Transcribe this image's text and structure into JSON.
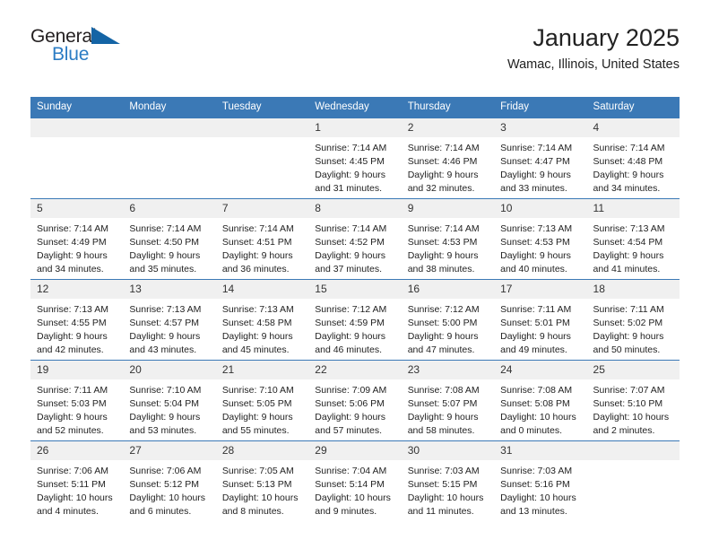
{
  "brand": {
    "word_one": "General",
    "word_two": "Blue",
    "triangle_icon": "triangle-logo-icon",
    "colors": {
      "dark": "#231f20",
      "blue": "#2b7cc4",
      "triangle": "#1464a5"
    }
  },
  "header": {
    "title": "January 2025",
    "subtitle": "Wamac, Illinois, United States"
  },
  "theme": {
    "header_blue": "#3b79b6",
    "daynum_band": "#f0f0f0",
    "text": "#222222"
  },
  "weekdays": [
    "Sunday",
    "Monday",
    "Tuesday",
    "Wednesday",
    "Thursday",
    "Friday",
    "Saturday"
  ],
  "weeks": [
    [
      {
        "day": "",
        "empty": true,
        "lines": []
      },
      {
        "day": "",
        "empty": true,
        "lines": []
      },
      {
        "day": "",
        "empty": true,
        "lines": []
      },
      {
        "day": "1",
        "empty": false,
        "lines": [
          "Sunrise: 7:14 AM",
          "Sunset: 4:45 PM",
          "Daylight: 9 hours",
          "and 31 minutes."
        ]
      },
      {
        "day": "2",
        "empty": false,
        "lines": [
          "Sunrise: 7:14 AM",
          "Sunset: 4:46 PM",
          "Daylight: 9 hours",
          "and 32 minutes."
        ]
      },
      {
        "day": "3",
        "empty": false,
        "lines": [
          "Sunrise: 7:14 AM",
          "Sunset: 4:47 PM",
          "Daylight: 9 hours",
          "and 33 minutes."
        ]
      },
      {
        "day": "4",
        "empty": false,
        "lines": [
          "Sunrise: 7:14 AM",
          "Sunset: 4:48 PM",
          "Daylight: 9 hours",
          "and 34 minutes."
        ]
      }
    ],
    [
      {
        "day": "5",
        "empty": false,
        "lines": [
          "Sunrise: 7:14 AM",
          "Sunset: 4:49 PM",
          "Daylight: 9 hours",
          "and 34 minutes."
        ]
      },
      {
        "day": "6",
        "empty": false,
        "lines": [
          "Sunrise: 7:14 AM",
          "Sunset: 4:50 PM",
          "Daylight: 9 hours",
          "and 35 minutes."
        ]
      },
      {
        "day": "7",
        "empty": false,
        "lines": [
          "Sunrise: 7:14 AM",
          "Sunset: 4:51 PM",
          "Daylight: 9 hours",
          "and 36 minutes."
        ]
      },
      {
        "day": "8",
        "empty": false,
        "lines": [
          "Sunrise: 7:14 AM",
          "Sunset: 4:52 PM",
          "Daylight: 9 hours",
          "and 37 minutes."
        ]
      },
      {
        "day": "9",
        "empty": false,
        "lines": [
          "Sunrise: 7:14 AM",
          "Sunset: 4:53 PM",
          "Daylight: 9 hours",
          "and 38 minutes."
        ]
      },
      {
        "day": "10",
        "empty": false,
        "lines": [
          "Sunrise: 7:13 AM",
          "Sunset: 4:53 PM",
          "Daylight: 9 hours",
          "and 40 minutes."
        ]
      },
      {
        "day": "11",
        "empty": false,
        "lines": [
          "Sunrise: 7:13 AM",
          "Sunset: 4:54 PM",
          "Daylight: 9 hours",
          "and 41 minutes."
        ]
      }
    ],
    [
      {
        "day": "12",
        "empty": false,
        "lines": [
          "Sunrise: 7:13 AM",
          "Sunset: 4:55 PM",
          "Daylight: 9 hours",
          "and 42 minutes."
        ]
      },
      {
        "day": "13",
        "empty": false,
        "lines": [
          "Sunrise: 7:13 AM",
          "Sunset: 4:57 PM",
          "Daylight: 9 hours",
          "and 43 minutes."
        ]
      },
      {
        "day": "14",
        "empty": false,
        "lines": [
          "Sunrise: 7:13 AM",
          "Sunset: 4:58 PM",
          "Daylight: 9 hours",
          "and 45 minutes."
        ]
      },
      {
        "day": "15",
        "empty": false,
        "lines": [
          "Sunrise: 7:12 AM",
          "Sunset: 4:59 PM",
          "Daylight: 9 hours",
          "and 46 minutes."
        ]
      },
      {
        "day": "16",
        "empty": false,
        "lines": [
          "Sunrise: 7:12 AM",
          "Sunset: 5:00 PM",
          "Daylight: 9 hours",
          "and 47 minutes."
        ]
      },
      {
        "day": "17",
        "empty": false,
        "lines": [
          "Sunrise: 7:11 AM",
          "Sunset: 5:01 PM",
          "Daylight: 9 hours",
          "and 49 minutes."
        ]
      },
      {
        "day": "18",
        "empty": false,
        "lines": [
          "Sunrise: 7:11 AM",
          "Sunset: 5:02 PM",
          "Daylight: 9 hours",
          "and 50 minutes."
        ]
      }
    ],
    [
      {
        "day": "19",
        "empty": false,
        "lines": [
          "Sunrise: 7:11 AM",
          "Sunset: 5:03 PM",
          "Daylight: 9 hours",
          "and 52 minutes."
        ]
      },
      {
        "day": "20",
        "empty": false,
        "lines": [
          "Sunrise: 7:10 AM",
          "Sunset: 5:04 PM",
          "Daylight: 9 hours",
          "and 53 minutes."
        ]
      },
      {
        "day": "21",
        "empty": false,
        "lines": [
          "Sunrise: 7:10 AM",
          "Sunset: 5:05 PM",
          "Daylight: 9 hours",
          "and 55 minutes."
        ]
      },
      {
        "day": "22",
        "empty": false,
        "lines": [
          "Sunrise: 7:09 AM",
          "Sunset: 5:06 PM",
          "Daylight: 9 hours",
          "and 57 minutes."
        ]
      },
      {
        "day": "23",
        "empty": false,
        "lines": [
          "Sunrise: 7:08 AM",
          "Sunset: 5:07 PM",
          "Daylight: 9 hours",
          "and 58 minutes."
        ]
      },
      {
        "day": "24",
        "empty": false,
        "lines": [
          "Sunrise: 7:08 AM",
          "Sunset: 5:08 PM",
          "Daylight: 10 hours",
          "and 0 minutes."
        ]
      },
      {
        "day": "25",
        "empty": false,
        "lines": [
          "Sunrise: 7:07 AM",
          "Sunset: 5:10 PM",
          "Daylight: 10 hours",
          "and 2 minutes."
        ]
      }
    ],
    [
      {
        "day": "26",
        "empty": false,
        "lines": [
          "Sunrise: 7:06 AM",
          "Sunset: 5:11 PM",
          "Daylight: 10 hours",
          "and 4 minutes."
        ]
      },
      {
        "day": "27",
        "empty": false,
        "lines": [
          "Sunrise: 7:06 AM",
          "Sunset: 5:12 PM",
          "Daylight: 10 hours",
          "and 6 minutes."
        ]
      },
      {
        "day": "28",
        "empty": false,
        "lines": [
          "Sunrise: 7:05 AM",
          "Sunset: 5:13 PM",
          "Daylight: 10 hours",
          "and 8 minutes."
        ]
      },
      {
        "day": "29",
        "empty": false,
        "lines": [
          "Sunrise: 7:04 AM",
          "Sunset: 5:14 PM",
          "Daylight: 10 hours",
          "and 9 minutes."
        ]
      },
      {
        "day": "30",
        "empty": false,
        "lines": [
          "Sunrise: 7:03 AM",
          "Sunset: 5:15 PM",
          "Daylight: 10 hours",
          "and 11 minutes."
        ]
      },
      {
        "day": "31",
        "empty": false,
        "lines": [
          "Sunrise: 7:03 AM",
          "Sunset: 5:16 PM",
          "Daylight: 10 hours",
          "and 13 minutes."
        ]
      },
      {
        "day": "",
        "empty": true,
        "lines": []
      }
    ]
  ]
}
